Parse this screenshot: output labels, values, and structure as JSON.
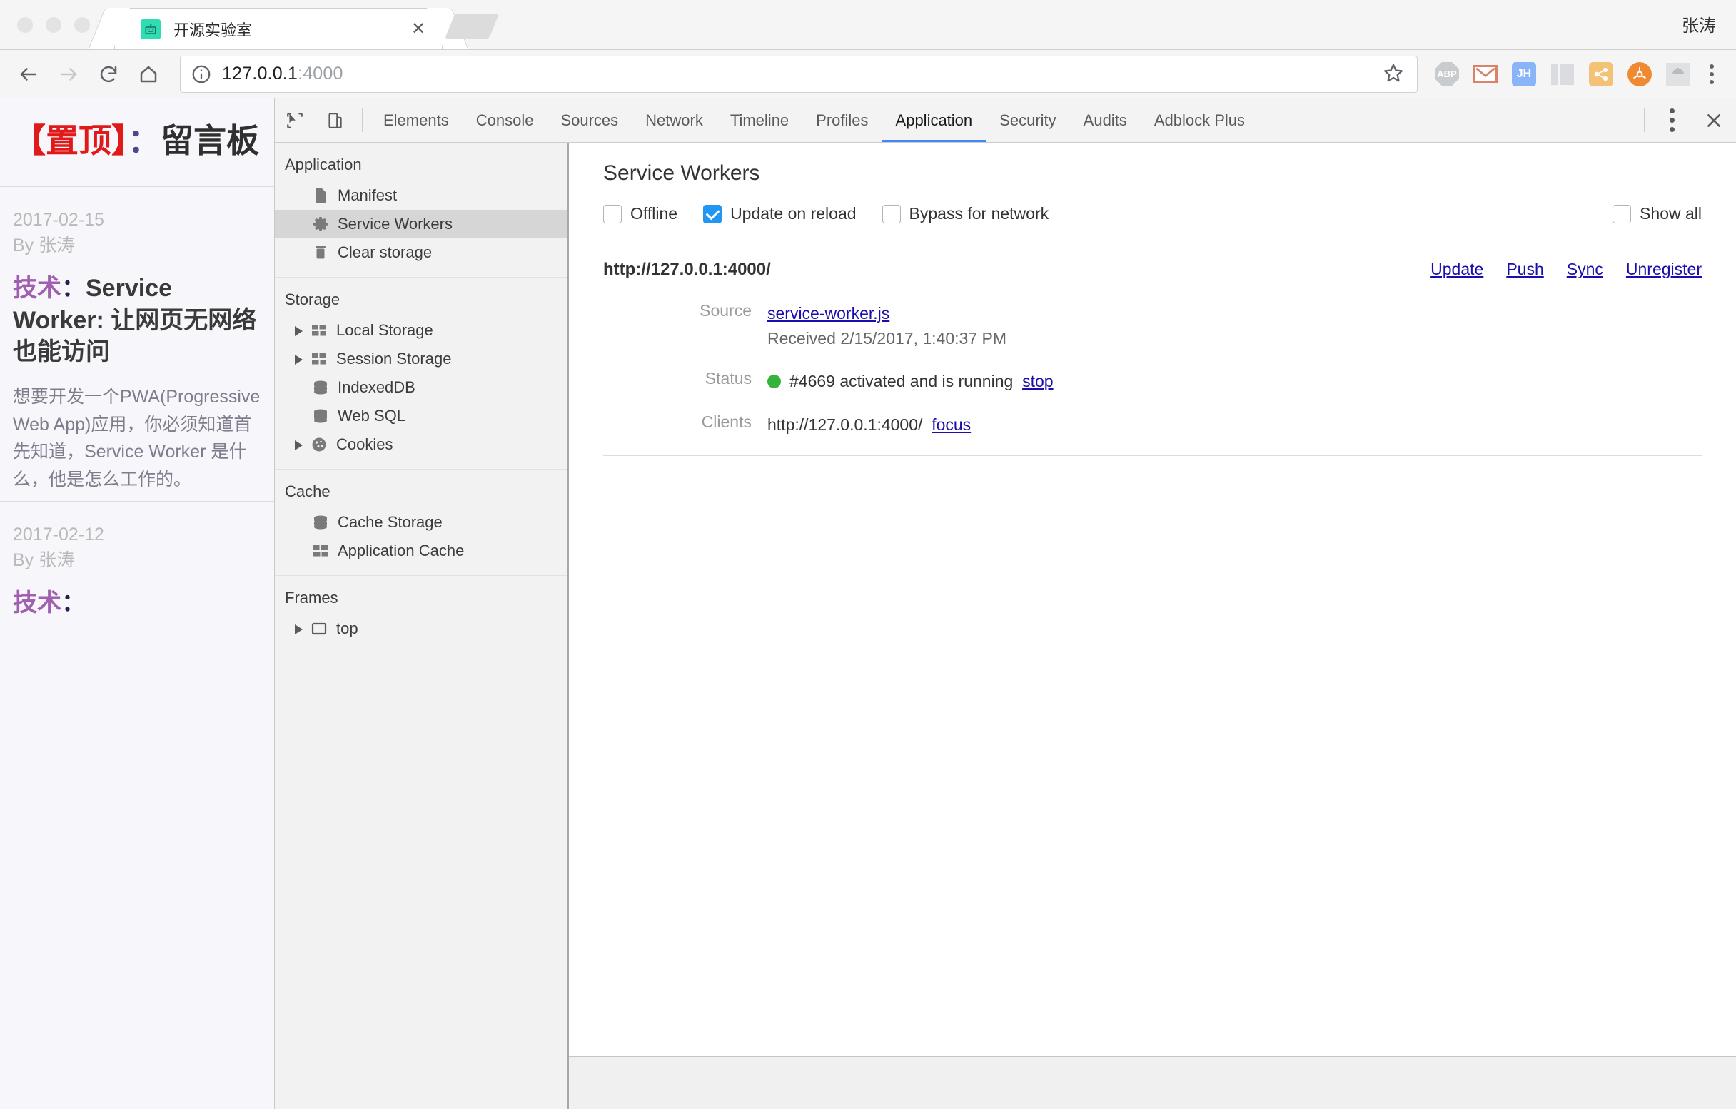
{
  "browser": {
    "tab": {
      "title": "开源实验室",
      "favicon_icon": "keyboard-icon",
      "close_icon": "close-icon"
    },
    "new_tab_label": "",
    "profile_name": "张涛",
    "nav": {
      "back_icon": "arrow-left-icon",
      "forward_icon": "arrow-right-icon",
      "reload_icon": "reload-icon",
      "home_icon": "home-icon"
    },
    "omnibox": {
      "info_icon": "info-circle-icon",
      "url_host": "127.0.0.1",
      "url_port": ":4000",
      "star_icon": "star-icon"
    },
    "extensions": [
      {
        "name": "adblock-plus-extension-icon",
        "label": "ABP"
      },
      {
        "name": "gmail-extension-icon",
        "label": ""
      },
      {
        "name": "jh-extension-icon",
        "label": "JH"
      },
      {
        "name": "columns-extension-icon",
        "label": ""
      },
      {
        "name": "share-extension-icon",
        "label": ""
      },
      {
        "name": "orange-extension-icon",
        "label": ""
      },
      {
        "name": "android-download-extension-icon",
        "label": ""
      }
    ],
    "menu_icon": "kebab-menu-icon"
  },
  "page": {
    "pinned_post": {
      "bracket_open": "【",
      "pinned_text": "置顶",
      "bracket_close": "】",
      "colon": "：",
      "title": "留言板"
    },
    "posts": [
      {
        "date": "2017-02-15",
        "author": "By 张涛",
        "category": "技术",
        "colon": "：",
        "title": "Service Worker: 让网页无网络也能访问",
        "body": "想要开发一个PWA(Progressive Web App)应用，你必须知道首先知道，Service Worker 是什么，他是怎么工作的。"
      },
      {
        "date": "2017-02-12",
        "author": "By 张涛",
        "category": "技术",
        "colon": "：",
        "title": "",
        "body": ""
      }
    ]
  },
  "devtools": {
    "inspect_icon": "inspect-cursor-icon",
    "device_toolbar_icon": "device-toolbar-icon",
    "tabs": [
      {
        "label": "Elements",
        "active": false
      },
      {
        "label": "Console",
        "active": false
      },
      {
        "label": "Sources",
        "active": false
      },
      {
        "label": "Network",
        "active": false
      },
      {
        "label": "Timeline",
        "active": false
      },
      {
        "label": "Profiles",
        "active": false
      },
      {
        "label": "Application",
        "active": true
      },
      {
        "label": "Security",
        "active": false
      },
      {
        "label": "Audits",
        "active": false
      },
      {
        "label": "Adblock Plus",
        "active": false
      }
    ],
    "more_icon": "kebab-menu-icon",
    "close_icon": "close-icon",
    "sidebar": {
      "groups": [
        {
          "title": "Application",
          "items": [
            {
              "label": "Manifest",
              "icon": "document-icon",
              "arrow": false,
              "selected": false
            },
            {
              "label": "Service Workers",
              "icon": "gear-icon",
              "arrow": false,
              "selected": true
            },
            {
              "label": "Clear storage",
              "icon": "trash-icon",
              "arrow": false,
              "selected": false
            }
          ]
        },
        {
          "title": "Storage",
          "items": [
            {
              "label": "Local Storage",
              "icon": "table-icon",
              "arrow": true,
              "selected": false
            },
            {
              "label": "Session Storage",
              "icon": "table-icon",
              "arrow": true,
              "selected": false
            },
            {
              "label": "IndexedDB",
              "icon": "database-icon",
              "arrow": false,
              "selected": false
            },
            {
              "label": "Web SQL",
              "icon": "database-icon",
              "arrow": false,
              "selected": false
            },
            {
              "label": "Cookies",
              "icon": "cookie-icon",
              "arrow": true,
              "selected": false
            }
          ]
        },
        {
          "title": "Cache",
          "items": [
            {
              "label": "Cache Storage",
              "icon": "database-icon",
              "arrow": false,
              "selected": false
            },
            {
              "label": "Application Cache",
              "icon": "table-icon",
              "arrow": false,
              "selected": false
            }
          ]
        },
        {
          "title": "Frames",
          "items": [
            {
              "label": "top",
              "icon": "frame-icon",
              "arrow": true,
              "selected": false
            }
          ]
        }
      ]
    },
    "service_workers": {
      "panel_title": "Service Workers",
      "checkboxes": [
        {
          "label": "Offline",
          "checked": false
        },
        {
          "label": "Update on reload",
          "checked": true
        },
        {
          "label": "Bypass for network",
          "checked": false
        }
      ],
      "show_all": {
        "label": "Show all",
        "checked": false
      },
      "registration": {
        "scope": "http://127.0.0.1:4000/",
        "actions": [
          "Update",
          "Push",
          "Sync",
          "Unregister"
        ],
        "rows": [
          {
            "label": "Source",
            "link": "service-worker.js",
            "sub": "Received 2/15/2017, 1:40:37 PM"
          },
          {
            "label": "Status",
            "dot_color": "#35b43a",
            "text": "#4669 activated and is running",
            "action": "stop"
          },
          {
            "label": "Clients",
            "text": "http://127.0.0.1:4000/",
            "action": "focus"
          }
        ]
      }
    }
  }
}
